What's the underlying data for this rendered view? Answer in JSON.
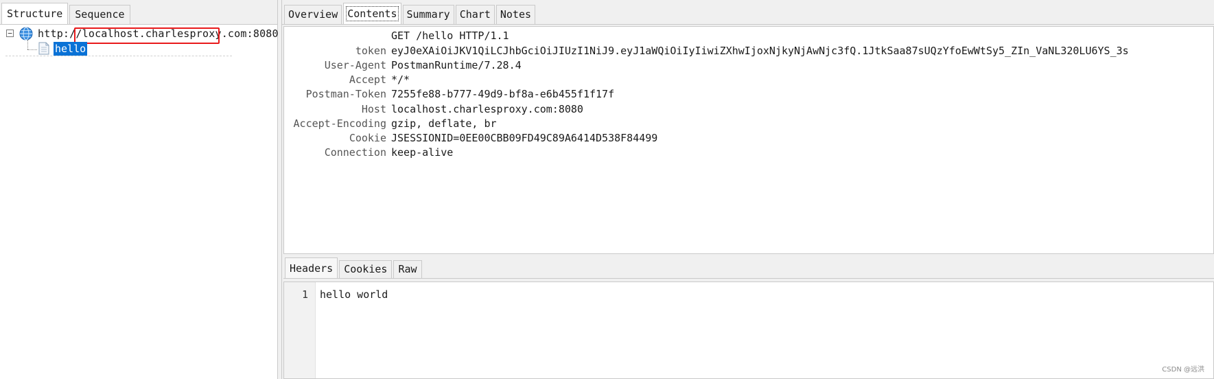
{
  "left_tabs": [
    {
      "label": "Structure"
    },
    {
      "label": "Sequence"
    }
  ],
  "tree": {
    "host": "http://localhost.charlesproxy.com:8080",
    "child": "hello"
  },
  "right_tabs": [
    {
      "label": "Overview"
    },
    {
      "label": "Contents"
    },
    {
      "label": "Summary"
    },
    {
      "label": "Chart"
    },
    {
      "label": "Notes"
    }
  ],
  "request": {
    "request_line": "GET /hello HTTP/1.1",
    "headers": [
      {
        "key": "token",
        "value": "eyJ0eXAiOiJKV1QiLCJhbGciOiJIUzI1NiJ9.eyJ1aWQiOiIyIiwiZXhwIjoxNjkyNjAwNjc3fQ.1JtkSaa87sUQzYfoEwWtSy5_ZIn_VaNL320LU6YS_3s"
      },
      {
        "key": "User-Agent",
        "value": "PostmanRuntime/7.28.4"
      },
      {
        "key": "Accept",
        "value": "*/*"
      },
      {
        "key": "Postman-Token",
        "value": "7255fe88-b777-49d9-bf8a-e6b455f1f17f"
      },
      {
        "key": "Host",
        "value": "localhost.charlesproxy.com:8080"
      },
      {
        "key": "Accept-Encoding",
        "value": "gzip, deflate, br"
      },
      {
        "key": "Cookie",
        "value": "JSESSIONID=0EE00CBB09FD49C89A6414D538F84499"
      },
      {
        "key": "Connection",
        "value": "keep-alive"
      }
    ]
  },
  "bottom_tabs": [
    {
      "label": "Headers"
    },
    {
      "label": "Cookies"
    },
    {
      "label": "Raw"
    }
  ],
  "response": {
    "line_number": "1",
    "body": "hello world"
  },
  "watermark": "CSDN @远洪",
  "colors": {
    "selection": "#0a72d6",
    "highlight_box": "#e8191a"
  }
}
